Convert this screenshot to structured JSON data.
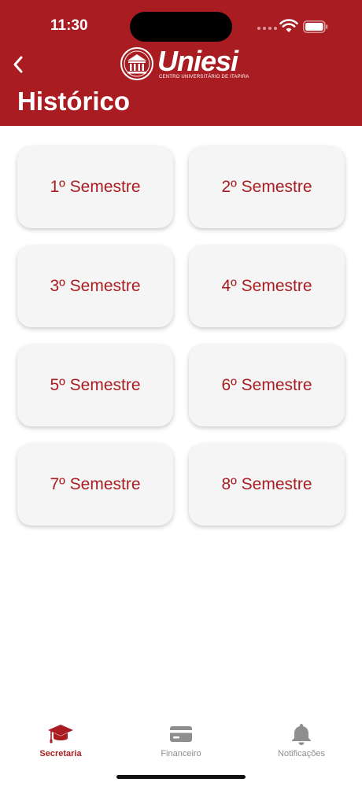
{
  "status_bar": {
    "time": "11:30",
    "wifi_icon": "wifi-icon",
    "battery_icon": "battery-icon"
  },
  "header": {
    "back_icon": "chevron-left-icon",
    "logo_text": "Uniesi",
    "logo_subtitle": "CENTRO UNIVERSITÁRIO DE ITAPIRA",
    "title": "Histórico"
  },
  "semesters": [
    {
      "label": "1º Semestre"
    },
    {
      "label": "2º Semestre"
    },
    {
      "label": "3º Semestre"
    },
    {
      "label": "4º Semestre"
    },
    {
      "label": "5º Semestre"
    },
    {
      "label": "6º Semestre"
    },
    {
      "label": "7º Semestre"
    },
    {
      "label": "8º Semestre"
    }
  ],
  "tabbar": {
    "items": [
      {
        "label": "Secretaria",
        "icon": "graduation-cap-icon",
        "active": true
      },
      {
        "label": "Financeiro",
        "icon": "credit-card-icon",
        "active": false
      },
      {
        "label": "Notificações",
        "icon": "bell-icon",
        "active": false
      }
    ]
  },
  "colors": {
    "brand": "#a91d22",
    "card_bg": "#f5f5f5",
    "inactive": "#8e8e8e"
  }
}
